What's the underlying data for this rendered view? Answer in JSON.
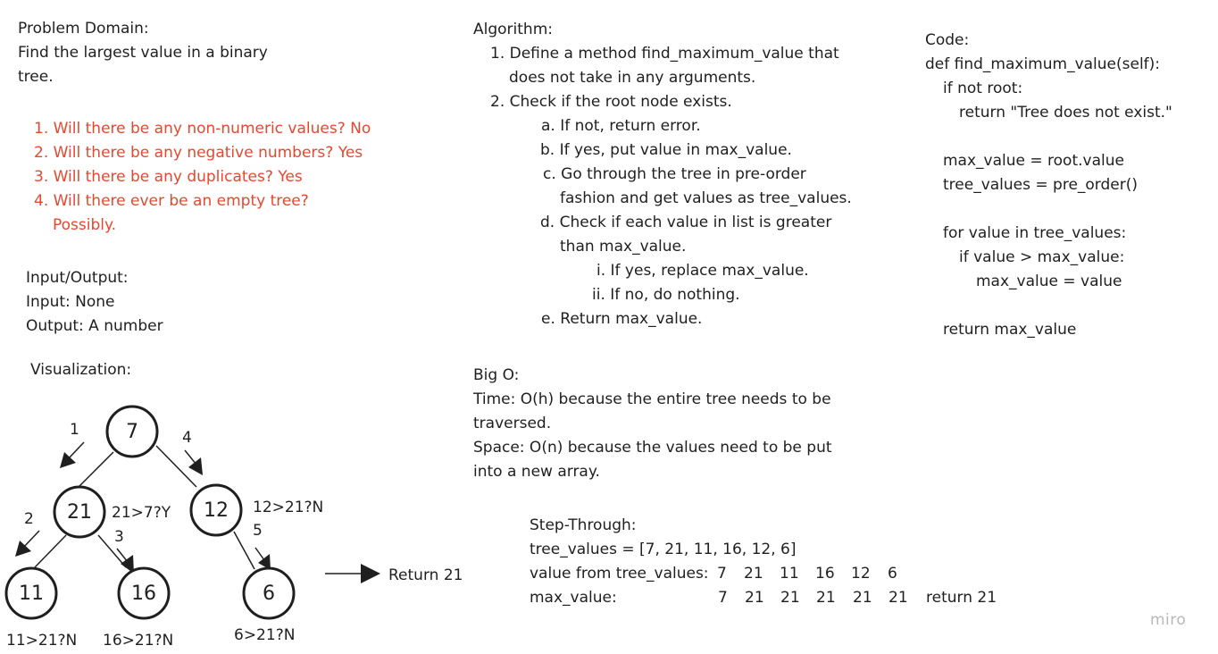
{
  "problem": {
    "heading": "Problem Domain:",
    "desc1": "Find the largest value in a binary",
    "desc2": "tree."
  },
  "questions": [
    "1. Will there be any non-numeric values? No",
    "2. Will there be any negative numbers? Yes",
    "3. Will there be any duplicates? Yes",
    "4. Will there ever be an empty tree?",
    "Possibly."
  ],
  "io": {
    "heading": "Input/Output:",
    "input": "Input: None",
    "output": "Output: A number"
  },
  "visualization": {
    "heading": "Visualization:",
    "nodes": {
      "root": "7",
      "left": "21",
      "right": "12",
      "ll": "11",
      "lr": "16",
      "rr": "6"
    },
    "step_labels": {
      "s1": "1",
      "s2": "2",
      "s3": "3",
      "s4": "4",
      "s5": "5"
    },
    "compare": {
      "n21": "21>7?Y",
      "n12": "12>21?N",
      "n11": "11>21?N",
      "n16": "16>21?N",
      "n6": "6>21?N"
    },
    "result": "Return 21"
  },
  "algorithm": {
    "heading": "Algorithm:",
    "lines": [
      "1. Define a method find_maximum_value that",
      "does not take in any arguments.",
      "2. Check if the root node exists.",
      "a. If not, return error.",
      "b. If yes, put value in max_value.",
      "c. Go through the tree in pre-order",
      "fashion and get values as tree_values.",
      "d. Check if each value in list is greater",
      "than max_value.",
      "i. If yes, replace max_value.",
      "ii. If no, do nothing.",
      "e. Return max_value."
    ]
  },
  "bigo": {
    "heading": "Big O:",
    "time1": "Time: O(h) because the entire tree needs to be",
    "time2": "traversed.",
    "space1": "Space: O(n) because the values need to be put",
    "space2": "into a new array."
  },
  "stepthrough": {
    "heading": "Step-Through:",
    "tree_values": "tree_values = [7, 21, 11, 16, 12, 6]",
    "row1_label": "value from tree_values:",
    "row1_values": [
      "7",
      "21",
      "11",
      "16",
      "12",
      "6"
    ],
    "row2_label": "max_value:",
    "row2_values": [
      "7",
      "21",
      "21",
      "21",
      "21",
      "21"
    ],
    "row2_end": "return 21"
  },
  "code": {
    "heading": "Code:",
    "lines": [
      "def find_maximum_value(self):",
      "    if not root:",
      "        return \"Tree does not exist.\"",
      "",
      "    max_value = root.value",
      "    tree_values = pre_order()",
      "",
      "    for value in tree_values:",
      "        if value > max_value:",
      "            max_value = value",
      "",
      "    return max_value"
    ]
  },
  "watermark": "miro"
}
